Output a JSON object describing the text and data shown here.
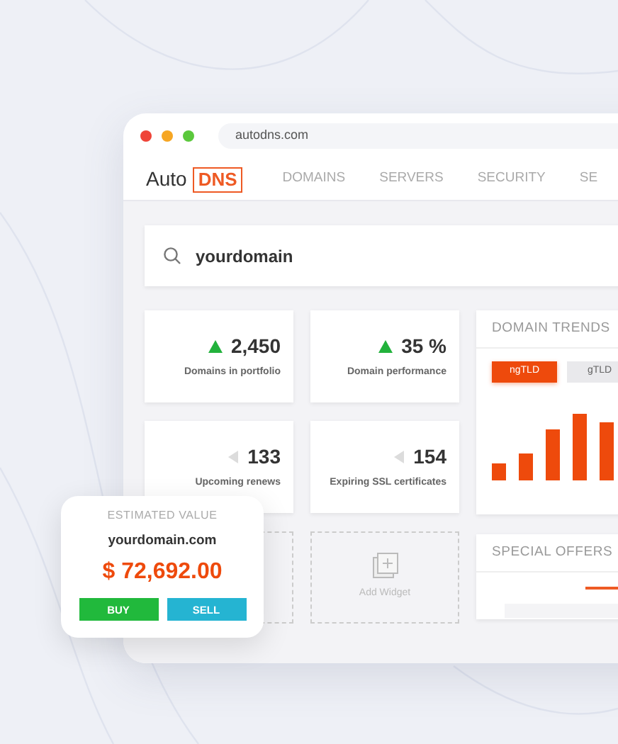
{
  "browser": {
    "url": "autodns.com"
  },
  "logo": {
    "text": "Auto",
    "boxed": "DNS"
  },
  "nav": [
    "DOMAINS",
    "SERVERS",
    "SECURITY",
    "SE"
  ],
  "search": {
    "value": "yourdomain"
  },
  "stats": [
    {
      "value": "2,450",
      "label": "Domains in portfolio",
      "kind": "up"
    },
    {
      "value": "35 %",
      "label": "Domain performance",
      "kind": "up"
    },
    {
      "value": "133",
      "label": "Upcoming renews",
      "kind": "flat"
    },
    {
      "value": "154",
      "label": "Expiring SSL certificates",
      "kind": "flat"
    }
  ],
  "add_widget": {
    "label": "Add Widget"
  },
  "domain_trends": {
    "title": "DOMAIN TRENDS",
    "tabs": [
      {
        "label": "ngTLD",
        "selected": true
      },
      {
        "label": "gTLD",
        "selected": false
      }
    ]
  },
  "special_offers": {
    "title": "SPECIAL OFFERS"
  },
  "estimate": {
    "title": "ESTIMATED VALUE",
    "domain": "yourdomain.com",
    "price": "$ 72,692.00",
    "buttons": [
      {
        "label": "BUY",
        "kind": "buy"
      },
      {
        "label": "SELL",
        "kind": "sell"
      }
    ]
  }
}
